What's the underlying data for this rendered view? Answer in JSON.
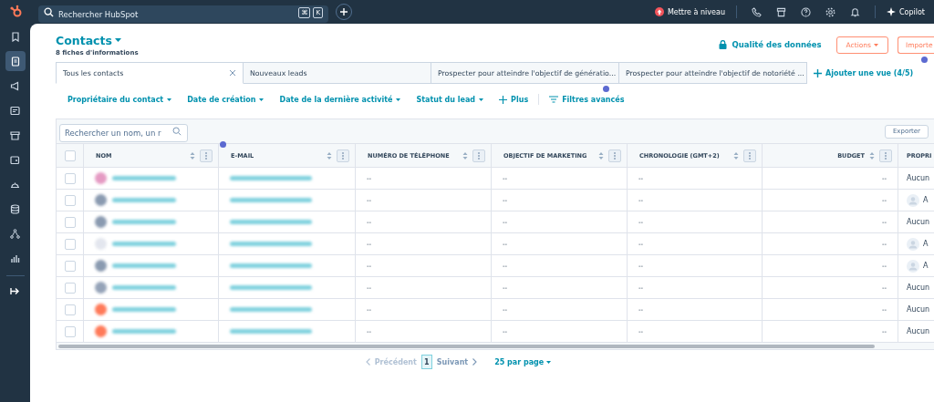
{
  "topbar": {
    "search_placeholder": "Rechercher HubSpot",
    "shortcut_keys": [
      "⌘",
      "K"
    ],
    "upgrade": "Mettre à niveau",
    "copilot": "Copilot"
  },
  "sidebar": {
    "items": [
      {
        "selected": false
      },
      {
        "selected": true
      },
      {
        "selected": false
      },
      {
        "selected": false
      },
      {
        "selected": false
      },
      {
        "selected": false
      },
      {
        "selected": false
      },
      {
        "selected": false
      },
      {
        "selected": false
      },
      {
        "selected": false
      }
    ]
  },
  "header": {
    "title": "Contacts",
    "subtitle": "8 fiches d'informations",
    "data_quality": "Qualité des données",
    "actions": "Actions",
    "import": "Importe"
  },
  "tabs": [
    {
      "label": "Tous les contacts",
      "selected": true
    },
    {
      "label": "Nouveaux leads",
      "selected": false
    },
    {
      "label": "Prospecter pour atteindre l'objectif de génératio...",
      "selected": false
    },
    {
      "label": "Prospecter pour atteindre l'objectif de notoriété ...",
      "selected": false
    }
  ],
  "add_view": "Ajouter une vue (4/5)",
  "filters": [
    "Propriétaire du contact",
    "Date de création",
    "Date de la dernière activité",
    "Statut du lead"
  ],
  "more": "Plus",
  "advanced_filters": "Filtres avancés",
  "table": {
    "search_placeholder": "Rechercher un nom, un r",
    "export": "Exporter",
    "select_all": {
      "checked": false
    },
    "columns": [
      "NOM",
      "E-MAIL",
      "NUMÉRO DE TÉLÉPHONE",
      "OBJECTIF DE MARKETING",
      "CHRONOLOGIE (GMT+2)",
      "BUDGET",
      "PROPRI"
    ],
    "rows": [
      {
        "color": "#e59ac3",
        "checked": false,
        "phone": "--",
        "objective": "--",
        "timeline": "--",
        "budget": "--",
        "owner": {
          "kind": "none",
          "text": "Aucun"
        }
      },
      {
        "color": "#8a9ab0",
        "checked": false,
        "phone": "--",
        "objective": "--",
        "timeline": "--",
        "budget": "--",
        "owner": {
          "kind": "user",
          "text": "A"
        }
      },
      {
        "color": "#8a9ab0",
        "checked": false,
        "phone": "--",
        "objective": "--",
        "timeline": "--",
        "budget": "--",
        "owner": {
          "kind": "none",
          "text": "Aucun"
        }
      },
      {
        "color": "#e3e6ee",
        "checked": false,
        "phone": "--",
        "objective": "--",
        "timeline": "--",
        "budget": "--",
        "owner": {
          "kind": "user",
          "text": "A"
        }
      },
      {
        "color": "#8a9ab0",
        "checked": false,
        "phone": "--",
        "objective": "--",
        "timeline": "--",
        "budget": "--",
        "owner": {
          "kind": "user",
          "text": "A"
        }
      },
      {
        "color": "#95a3b8",
        "checked": false,
        "phone": "--",
        "objective": "--",
        "timeline": "--",
        "budget": "--",
        "owner": {
          "kind": "none",
          "text": "Aucun"
        }
      },
      {
        "color": "#ff7a59",
        "checked": false,
        "phone": "--",
        "objective": "--",
        "timeline": "--",
        "budget": "--",
        "owner": {
          "kind": "none",
          "text": "Aucun"
        }
      },
      {
        "color": "#ff7a59",
        "checked": false,
        "phone": "--",
        "objective": "--",
        "timeline": "--",
        "budget": "--",
        "owner": {
          "kind": "none",
          "text": "Aucun"
        }
      }
    ]
  },
  "pagination": {
    "previous": {
      "label": "Précédent",
      "disabled": true
    },
    "pages": [
      {
        "label": "1",
        "selected": true
      }
    ],
    "next": {
      "label": "Suivant",
      "disabled": false
    },
    "per_page": "25 par page"
  }
}
